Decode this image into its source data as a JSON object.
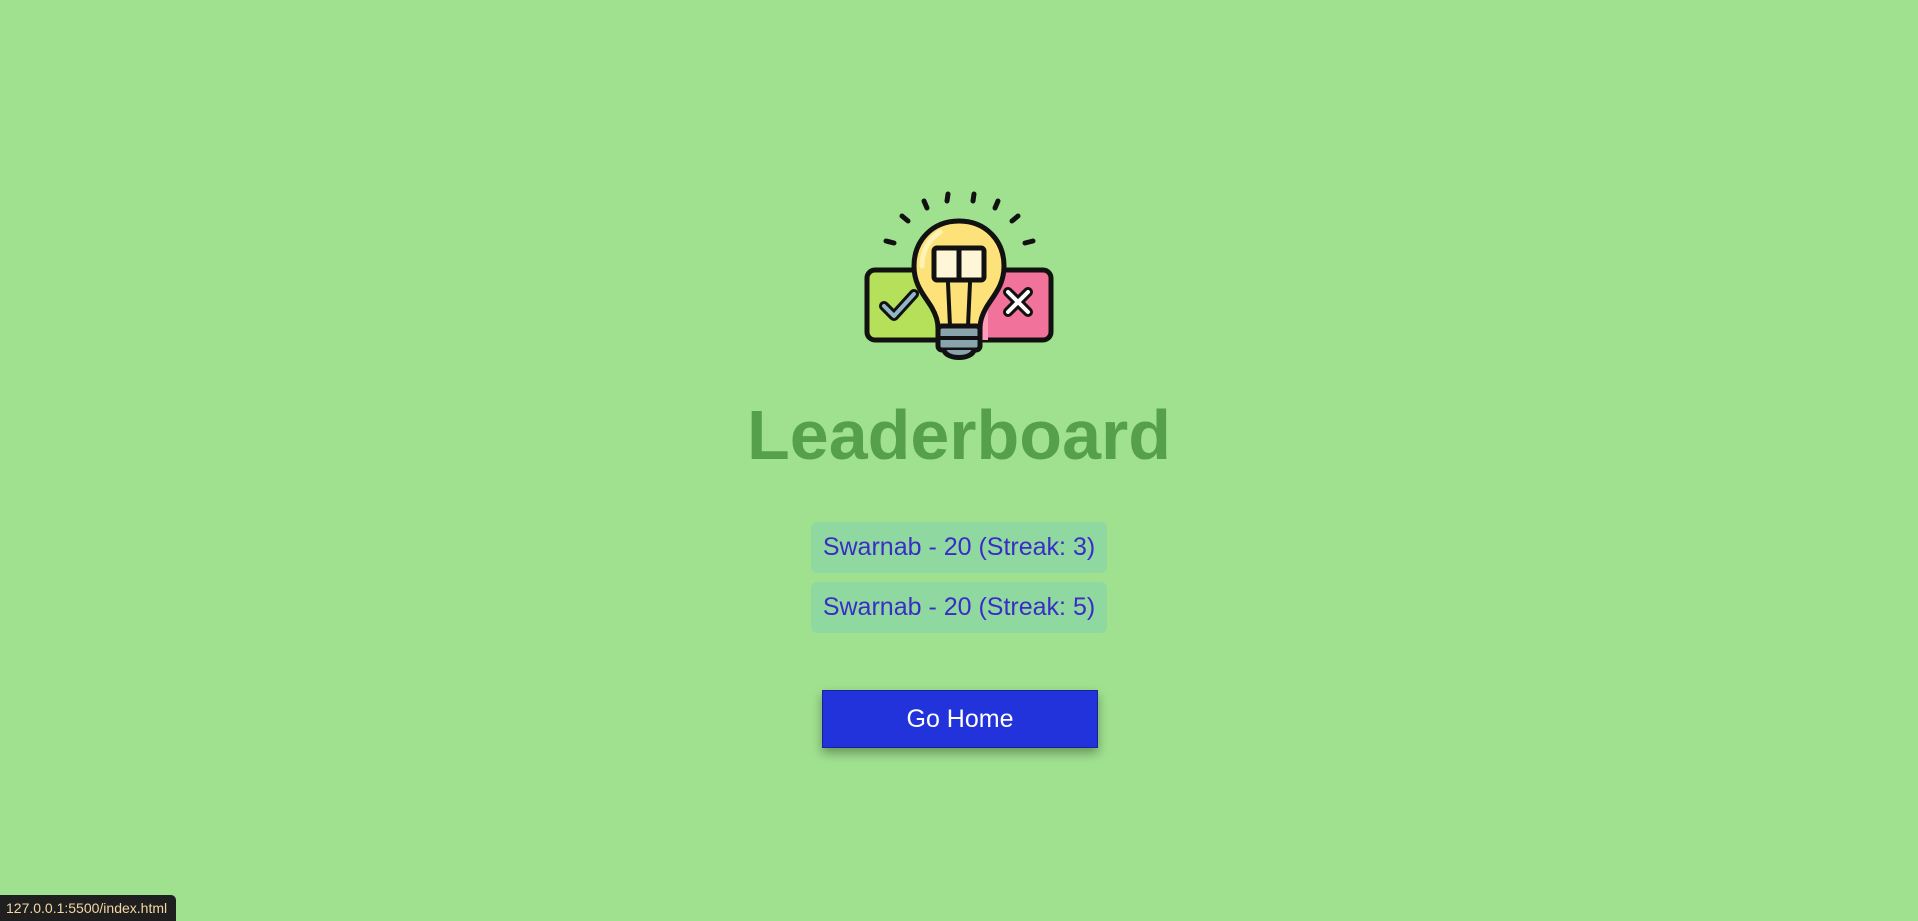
{
  "page": {
    "title": "Leaderboard",
    "logo_icon": "lightbulb-quiz-icon"
  },
  "leaderboard": {
    "entries": [
      {
        "text": "Swarnab - 20 (Streak: 3)"
      },
      {
        "text": "Swarnab - 20 (Streak: 5)"
      }
    ]
  },
  "actions": {
    "go_home_label": "Go Home"
  },
  "status_bar": {
    "url": "127.0.0.1:5500/index.html"
  },
  "colors": {
    "background": "#a0e18f",
    "title": "#56a04b",
    "entry_background": "#8fd9a0",
    "entry_text": "#3a2dc6",
    "button": "#2233db"
  }
}
